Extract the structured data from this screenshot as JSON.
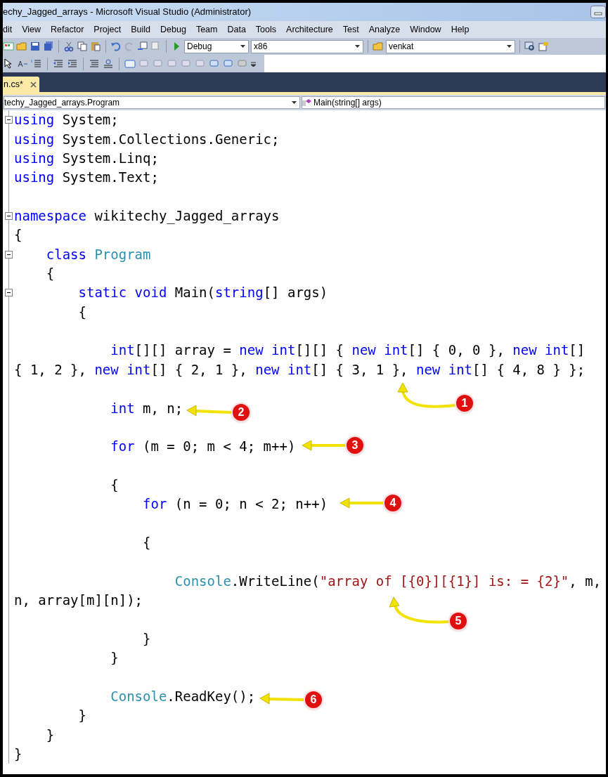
{
  "window": {
    "title": "echy_Jagged_arrays - Microsoft Visual Studio (Administrator)"
  },
  "menu": [
    "dit",
    "View",
    "Refactor",
    "Project",
    "Build",
    "Debug",
    "Team",
    "Data",
    "Tools",
    "Architecture",
    "Test",
    "Analyze",
    "Window",
    "Help"
  ],
  "toolbar": {
    "configuration": "Debug",
    "platform": "x86",
    "find": "venkat"
  },
  "tabs": [
    {
      "label": "n.cs*",
      "selected": true
    }
  ],
  "navigation": {
    "type": "techy_Jagged_arrays.Program",
    "member": "Main(string[] args)"
  },
  "code": [
    {
      "kind": "fold",
      "tokens": [
        {
          "kind": "keyword",
          "text": "using"
        },
        {
          "kind": "plain",
          "text": " System;"
        }
      ]
    },
    {
      "kind": "code",
      "tokens": [
        {
          "kind": "keyword",
          "text": "using"
        },
        {
          "kind": "plain",
          "text": " System.Collections.Generic;"
        }
      ]
    },
    {
      "kind": "code",
      "tokens": [
        {
          "kind": "keyword",
          "text": "using"
        },
        {
          "kind": "plain",
          "text": " System.Linq;"
        }
      ]
    },
    {
      "kind": "code",
      "tokens": [
        {
          "kind": "keyword",
          "text": "using"
        },
        {
          "kind": "plain",
          "text": " System.Text;"
        }
      ]
    },
    {
      "kind": "blank"
    },
    {
      "kind": "fold",
      "tokens": [
        {
          "kind": "keyword",
          "text": "namespace"
        },
        {
          "kind": "plain",
          "text": " wikitechy_Jagged_arrays"
        }
      ]
    },
    {
      "kind": "code",
      "tokens": [
        {
          "kind": "plain",
          "text": "{"
        }
      ]
    },
    {
      "kind": "fold",
      "tokens": [
        {
          "kind": "keyword",
          "text": "    class "
        },
        {
          "kind": "type",
          "text": "Program"
        }
      ]
    },
    {
      "kind": "code",
      "tokens": [
        {
          "kind": "plain",
          "text": "    {"
        }
      ]
    },
    {
      "kind": "fold",
      "tokens": [
        {
          "kind": "keyword",
          "text": "        static void"
        },
        {
          "kind": "plain",
          "text": " Main("
        },
        {
          "kind": "keyword",
          "text": "string"
        },
        {
          "kind": "plain",
          "text": "[] args)"
        }
      ]
    },
    {
      "kind": "code",
      "tokens": [
        {
          "kind": "plain",
          "text": "        {"
        }
      ]
    },
    {
      "kind": "blank"
    },
    {
      "kind": "code",
      "tokens": [
        {
          "kind": "keyword",
          "text": "            int"
        },
        {
          "kind": "plain",
          "text": "[][] array = "
        },
        {
          "kind": "keyword",
          "text": "new int"
        },
        {
          "kind": "plain",
          "text": "[][] { "
        },
        {
          "kind": "keyword",
          "text": "new int"
        },
        {
          "kind": "plain",
          "text": "[] { 0, 0 }, "
        },
        {
          "kind": "keyword",
          "text": "new int"
        },
        {
          "kind": "plain",
          "text": "[]"
        }
      ]
    },
    {
      "kind": "code",
      "tokens": [
        {
          "kind": "plain",
          "text": "{ 1, 2 }, "
        },
        {
          "kind": "keyword",
          "text": "new int"
        },
        {
          "kind": "plain",
          "text": "[] { 2, 1 }, "
        },
        {
          "kind": "keyword",
          "text": "new int"
        },
        {
          "kind": "plain",
          "text": "[] { 3, 1 }, "
        },
        {
          "kind": "keyword",
          "text": "new int"
        },
        {
          "kind": "plain",
          "text": "[] { 4, 8 } };"
        }
      ]
    },
    {
      "kind": "blank"
    },
    {
      "kind": "code",
      "tokens": [
        {
          "kind": "keyword",
          "text": "            int"
        },
        {
          "kind": "plain",
          "text": " m, n;"
        }
      ]
    },
    {
      "kind": "blank"
    },
    {
      "kind": "code",
      "tokens": [
        {
          "kind": "keyword",
          "text": "            for"
        },
        {
          "kind": "plain",
          "text": " (m = 0; m < 4; m++)"
        }
      ]
    },
    {
      "kind": "blank"
    },
    {
      "kind": "code",
      "tokens": [
        {
          "kind": "plain",
          "text": "            {"
        }
      ]
    },
    {
      "kind": "code",
      "tokens": [
        {
          "kind": "keyword",
          "text": "                for"
        },
        {
          "kind": "plain",
          "text": " (n = 0; n < 2; n++)"
        }
      ]
    },
    {
      "kind": "blank"
    },
    {
      "kind": "code",
      "tokens": [
        {
          "kind": "plain",
          "text": "                {"
        }
      ]
    },
    {
      "kind": "blank"
    },
    {
      "kind": "code",
      "tokens": [
        {
          "kind": "type",
          "text": "                    Console"
        },
        {
          "kind": "plain",
          "text": ".WriteLine("
        },
        {
          "kind": "string",
          "text": "\"array of [{0}][{1}] is: = {2}\""
        },
        {
          "kind": "plain",
          "text": ", m,"
        }
      ]
    },
    {
      "kind": "code",
      "tokens": [
        {
          "kind": "plain",
          "text": "n, array[m][n]);"
        }
      ]
    },
    {
      "kind": "blank"
    },
    {
      "kind": "code",
      "tokens": [
        {
          "kind": "plain",
          "text": "                }"
        }
      ]
    },
    {
      "kind": "code",
      "tokens": [
        {
          "kind": "plain",
          "text": "            }"
        }
      ]
    },
    {
      "kind": "blank"
    },
    {
      "kind": "code",
      "tokens": [
        {
          "kind": "type",
          "text": "            Console"
        },
        {
          "kind": "plain",
          "text": ".ReadKey();"
        }
      ]
    },
    {
      "kind": "code",
      "tokens": [
        {
          "kind": "plain",
          "text": "        }"
        }
      ]
    },
    {
      "kind": "code",
      "tokens": [
        {
          "kind": "plain",
          "text": "    }"
        }
      ]
    },
    {
      "kind": "code",
      "tokens": [
        {
          "kind": "plain",
          "text": "}"
        }
      ]
    }
  ],
  "callouts": [
    {
      "number": "1"
    },
    {
      "number": "2"
    },
    {
      "number": "3"
    },
    {
      "number": "4"
    },
    {
      "number": "5"
    },
    {
      "number": "6"
    }
  ]
}
